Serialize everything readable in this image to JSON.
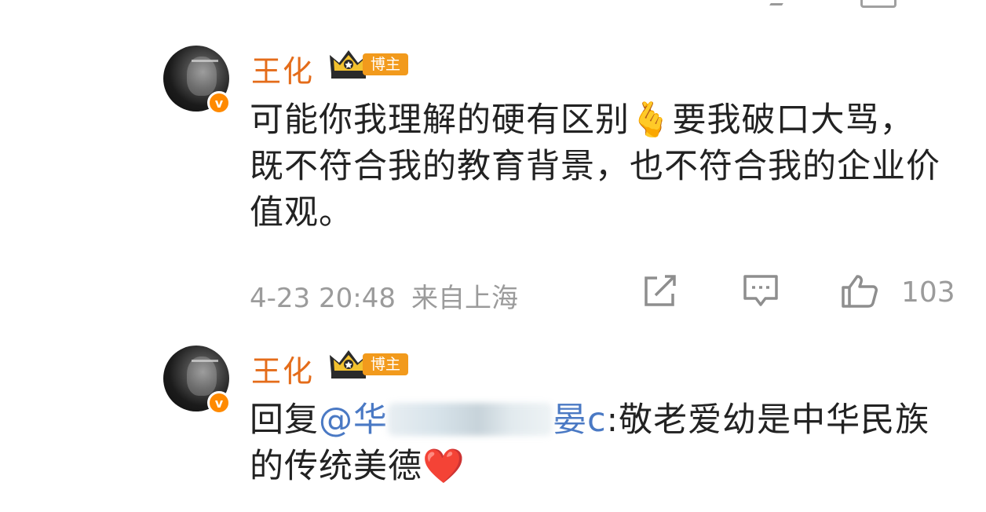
{
  "comments": [
    {
      "author": "王化",
      "badge": "博主",
      "verified": "v",
      "text": "可能你我理解的硬有区别",
      "emoji": "🫰",
      "text_after": "要我破口大骂，既不符合我的教育背景，也不符合我的企业价值观。",
      "time": "4-23 20:48",
      "location": "来自上海",
      "likes": "103"
    },
    {
      "author": "王化",
      "badge": "博主",
      "verified": "v",
      "reply_prefix": "回复",
      "mention_start": "@华",
      "mention_end": "晏c",
      "text_after": ":敬老爱幼是中华民族的传统美德",
      "emoji": "❤️"
    }
  ],
  "icons": {
    "share": "share-icon",
    "reply": "comment-icon",
    "like": "thumb-up-icon",
    "crown": "crown-icon"
  },
  "colors": {
    "name": "#e46c1a",
    "badge": "#f29a1c",
    "mention": "#4a79c4",
    "meta": "#9b9b9b"
  }
}
